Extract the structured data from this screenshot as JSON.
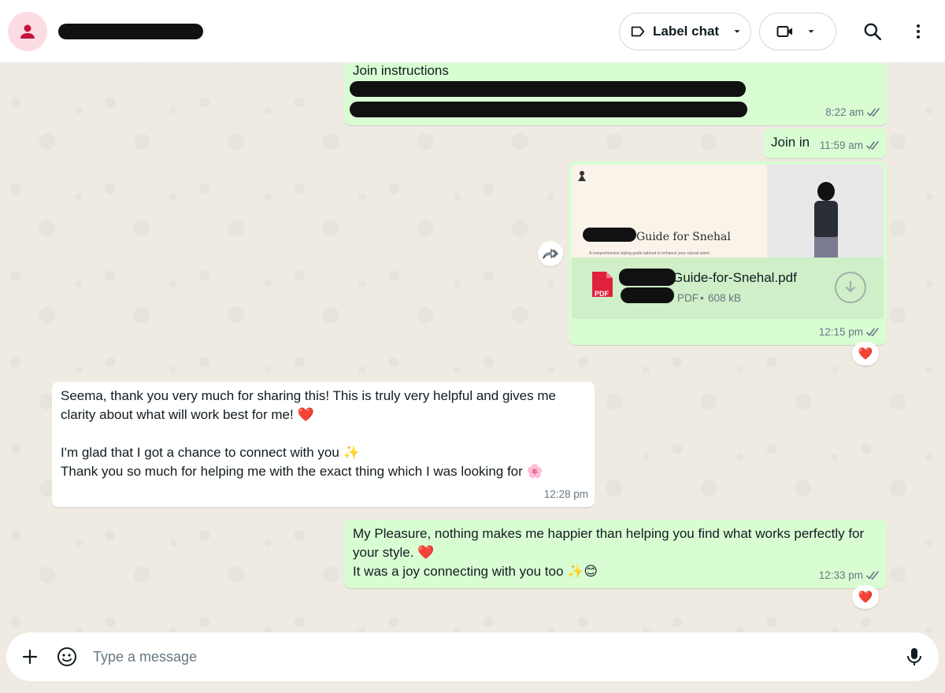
{
  "header": {
    "label_chat": "Label chat"
  },
  "messages": {
    "m1": {
      "text": "Join instructions",
      "time": "8:22 am"
    },
    "m2": {
      "text": "Join in",
      "time": "11:59 am"
    },
    "m3": {
      "preview_title": "Guide for Snehal",
      "preview_sub": "A comprehensive styling guide tailored to enhance your natural warm",
      "file_name": "Guide-for-Snehal.pdf",
      "file_type": "PDF",
      "file_size": "608 kB",
      "pdf_badge": "PDF",
      "time": "12:15 pm",
      "reaction": "❤️"
    },
    "m4": {
      "line1": "Seema, thank you very much for sharing this! This is truly very helpful and gives me",
      "line2": "clarity about what will work best for me! ❤️",
      "line3": "I'm glad that I got a chance to connect with you ✨",
      "line4": "Thank you so much for helping me with the exact thing which I was looking for 🌸",
      "time": "12:28 pm"
    },
    "m5": {
      "line1": "My Pleasure, nothing makes me happier than helping you find what works perfectly for",
      "line2": "your style. ❤️",
      "line3": "It was a joy connecting with you too ✨😊",
      "time": "12:33 pm",
      "reaction": "❤️"
    }
  },
  "composer": {
    "placeholder": "Type a message"
  },
  "colors": {
    "outgoing_bubble": "#d9fdd3",
    "incoming_bubble": "#ffffff",
    "chat_background": "#efeae2",
    "pdf_red": "#e0203c"
  }
}
